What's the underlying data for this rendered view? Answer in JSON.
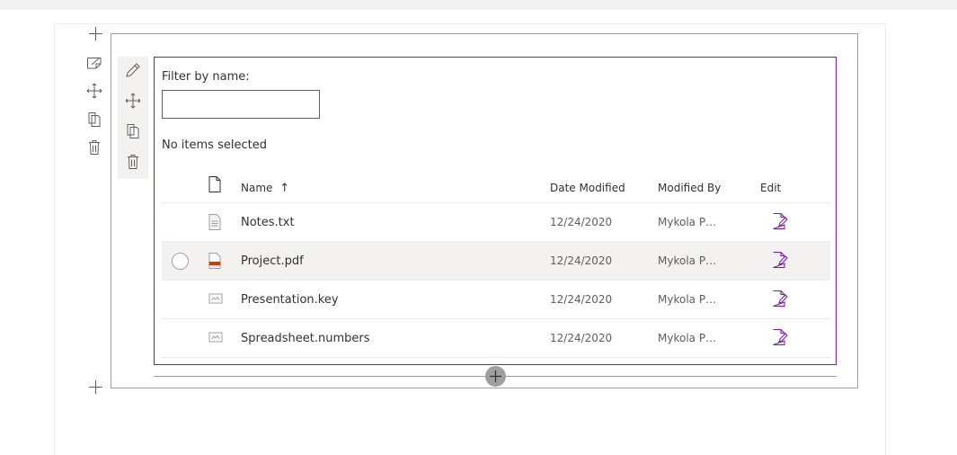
{
  "colors": {
    "accent": "#7b1fa2",
    "frame": "#a19f9d",
    "toolbar_bg": "#f3f2f1",
    "pdf_icon": "#d83b01"
  },
  "filter": {
    "label": "Filter by name:",
    "value": "",
    "placeholder": ""
  },
  "selection_status": "No items selected",
  "list": {
    "headers": {
      "type_icon": "document-icon",
      "name": "Name",
      "sort_indicator": "↑",
      "date_modified": "Date Modified",
      "modified_by": "Modified By",
      "edit": "Edit"
    },
    "rows": [
      {
        "name": "Notes.txt",
        "date": "12/24/2020",
        "modified_by": "Mykola Pyli...",
        "type_icon": "text-file-icon",
        "edit_icon": "edit-document-icon"
      },
      {
        "name": "Project.pdf",
        "date": "12/24/2020",
        "modified_by": "Mykola Pyli...",
        "type_icon": "pdf-file-icon",
        "edit_icon": "edit-document-icon"
      },
      {
        "name": "Presentation.key",
        "date": "12/24/2020",
        "modified_by": "Mykola Pyli...",
        "type_icon": "generic-file-icon",
        "edit_icon": "edit-document-icon"
      },
      {
        "name": "Spreadsheet.numbers",
        "date": "12/24/2020",
        "modified_by": "Mykola Pyli...",
        "type_icon": "generic-file-icon",
        "edit_icon": "edit-document-icon"
      }
    ]
  },
  "section_tools": [
    "edit-section-icon",
    "move-icon",
    "duplicate-icon",
    "delete-icon"
  ],
  "webpart_tools": [
    "pencil-icon",
    "move-icon",
    "duplicate-icon",
    "delete-icon"
  ]
}
